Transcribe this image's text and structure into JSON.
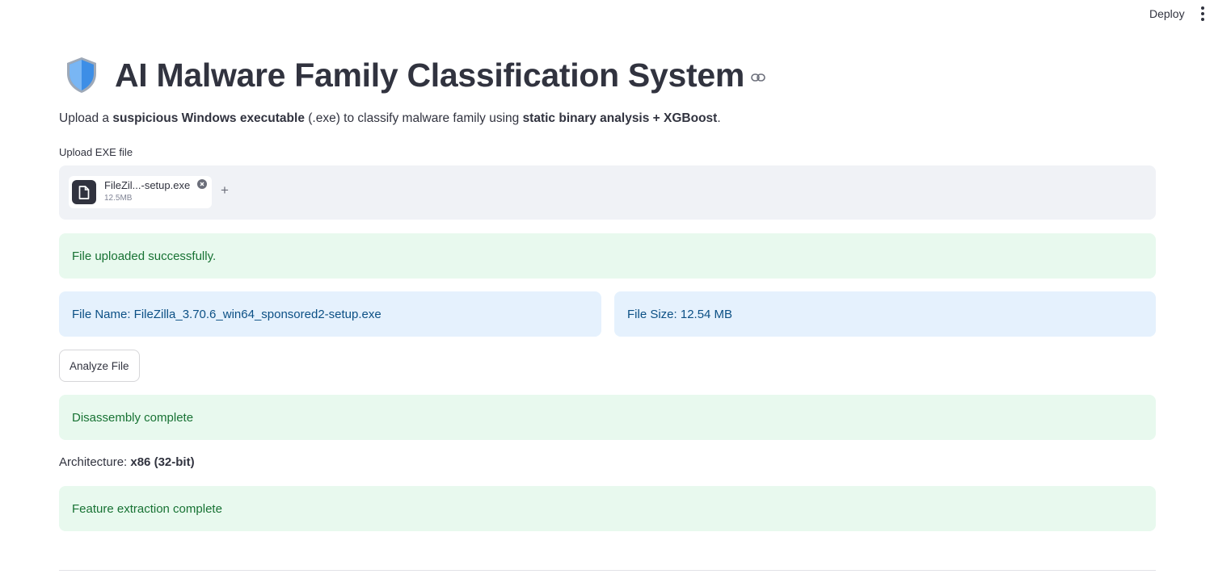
{
  "topbar": {
    "deploy_label": "Deploy"
  },
  "header": {
    "title": "AI Malware Family Classification System"
  },
  "subtitle": {
    "part1": "Upload a ",
    "bold1": "suspicious Windows executable",
    "part2": " (.exe) to classify malware family using ",
    "bold2": "static binary analysis + XGBoost",
    "part3": "."
  },
  "uploader": {
    "label": "Upload EXE file",
    "file_name": "FileZil...-setup.exe",
    "file_size": "12.5MB",
    "add_label": "+"
  },
  "messages": {
    "upload_success": "File uploaded successfully.",
    "file_name_info": "File Name: FileZilla_3.70.6_win64_sponsored2-setup.exe",
    "file_size_info": "File Size: 12.54 MB",
    "disassembly": "Disassembly complete",
    "feature_extraction": "Feature extraction complete"
  },
  "actions": {
    "analyze_label": "Analyze File"
  },
  "architecture": {
    "label": "Architecture: ",
    "value": "x86 (32-bit)"
  },
  "colors": {
    "success_bg": "#e8f9ee",
    "success_text": "#177233",
    "info_bg": "#e5f1fd",
    "info_text": "#0c5085",
    "shield_blue": "#3d8ee6"
  }
}
